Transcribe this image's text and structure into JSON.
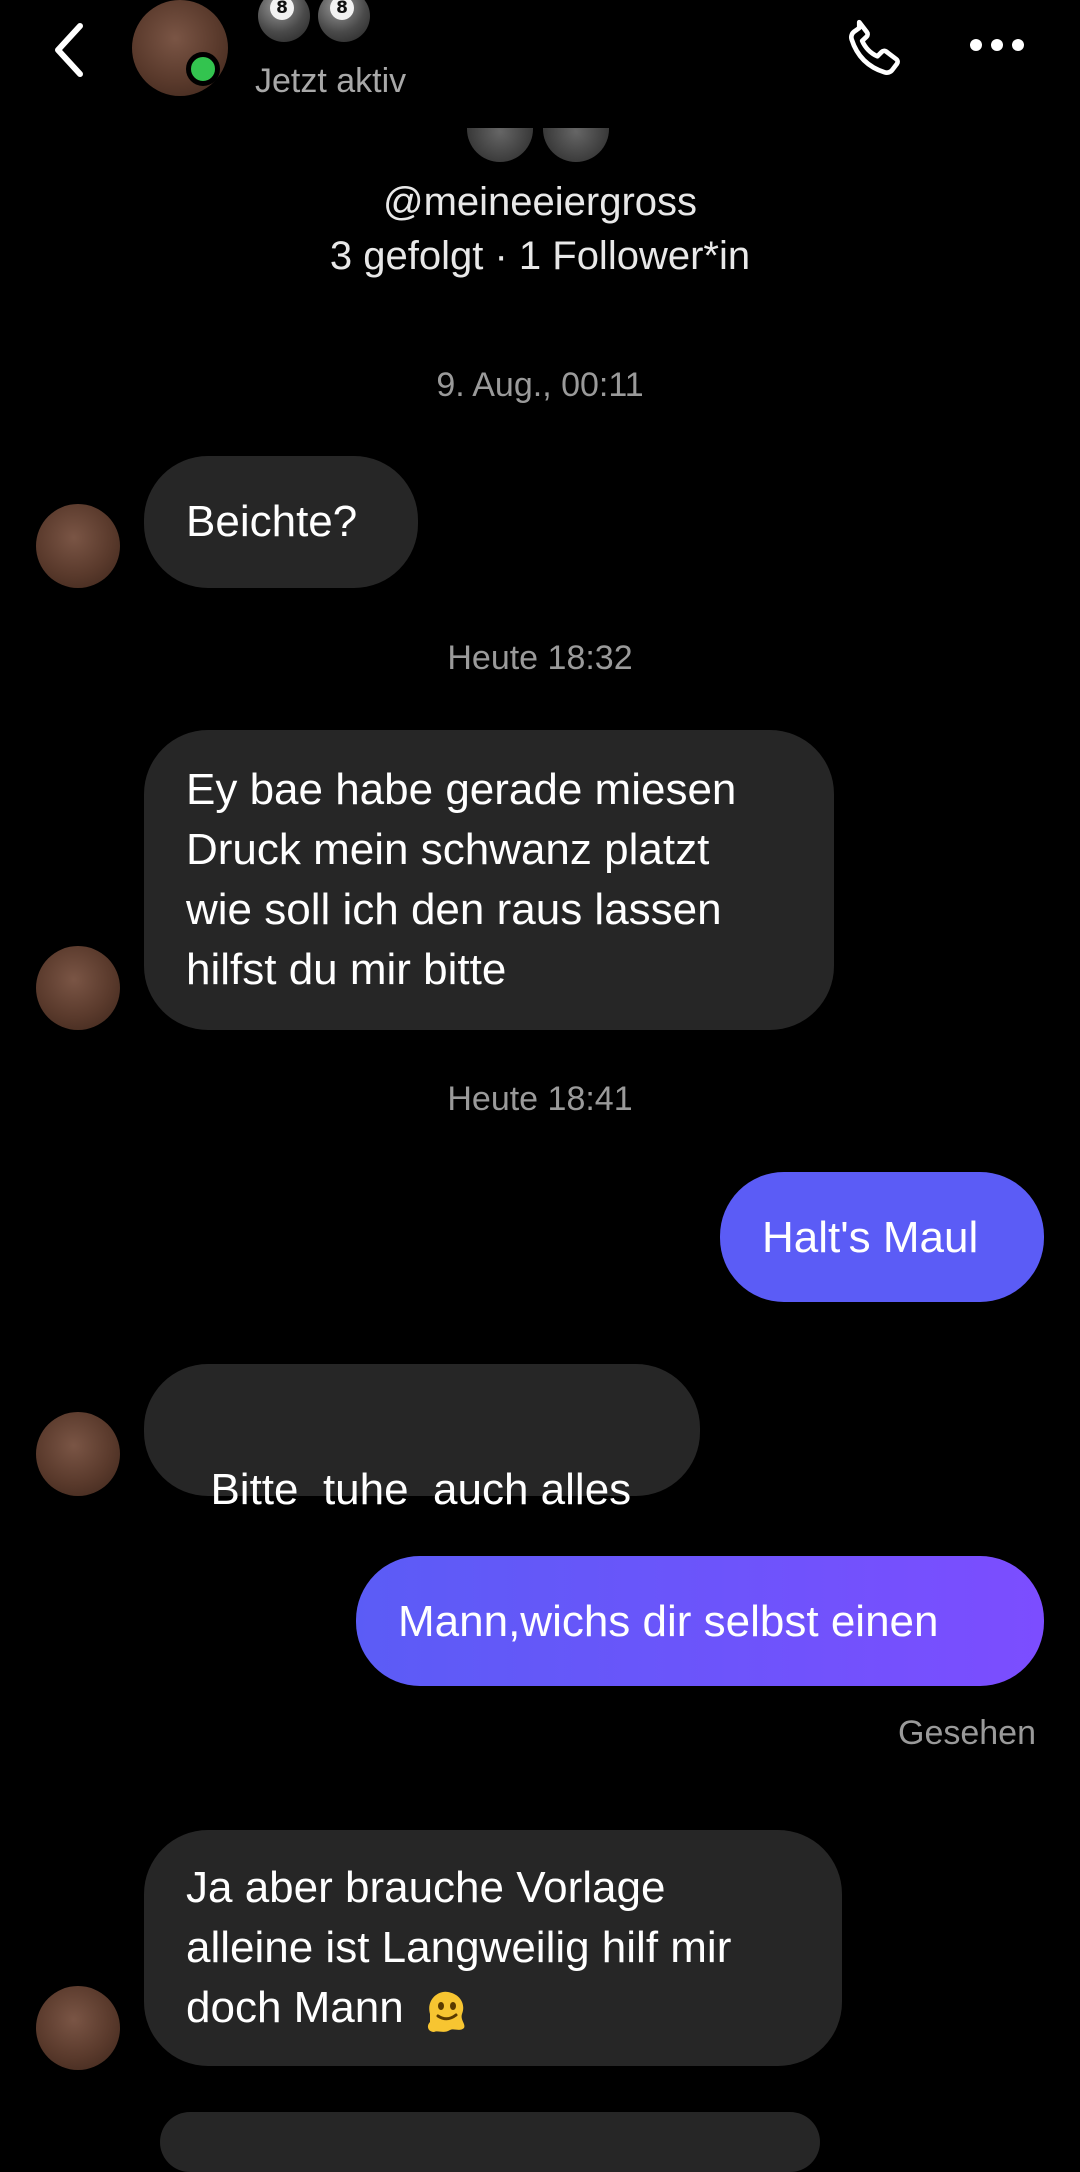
{
  "header": {
    "back_icon": "chevron-left-icon",
    "status": "Jetzt aktiv",
    "call_icon": "phone-icon",
    "more_icon": "more-horizontal-icon",
    "name_emoji": [
      "8",
      "8"
    ]
  },
  "profile": {
    "username": "@meineeiergross",
    "follow_stats": "3 gefolgt · 1 Follower*in"
  },
  "thread": {
    "timestamps": [
      "9. Aug., 00:11",
      "Heute 18:32",
      "Heute 18:41"
    ],
    "messages": [
      {
        "side": "in",
        "text": "Beichte?"
      },
      {
        "side": "in",
        "lines": [
          "Ey bae habe gerade miesen",
          "Druck mein schwanz platzt",
          "wie soll ich den raus lassen",
          "hilfst du mir bitte"
        ]
      },
      {
        "side": "out",
        "text": "Halt's Maul"
      },
      {
        "side": "in",
        "text": "Bitte  tuhe  auch alles"
      },
      {
        "side": "out",
        "text": "Mann,wichs dir selbst einen"
      },
      {
        "side": "in",
        "lines": [
          "Ja aber brauche Vorlage",
          "alleine ist Langweilig hilf mir",
          "doch Mann"
        ],
        "emoji": "melting-face-icon"
      }
    ],
    "seen": "Gesehen"
  },
  "colors": {
    "background": "#000000",
    "incoming_bubble": "#262626",
    "outgoing_start": "#5b5cf6",
    "outgoing_end": "#7c4dff",
    "online": "#33c44f"
  }
}
